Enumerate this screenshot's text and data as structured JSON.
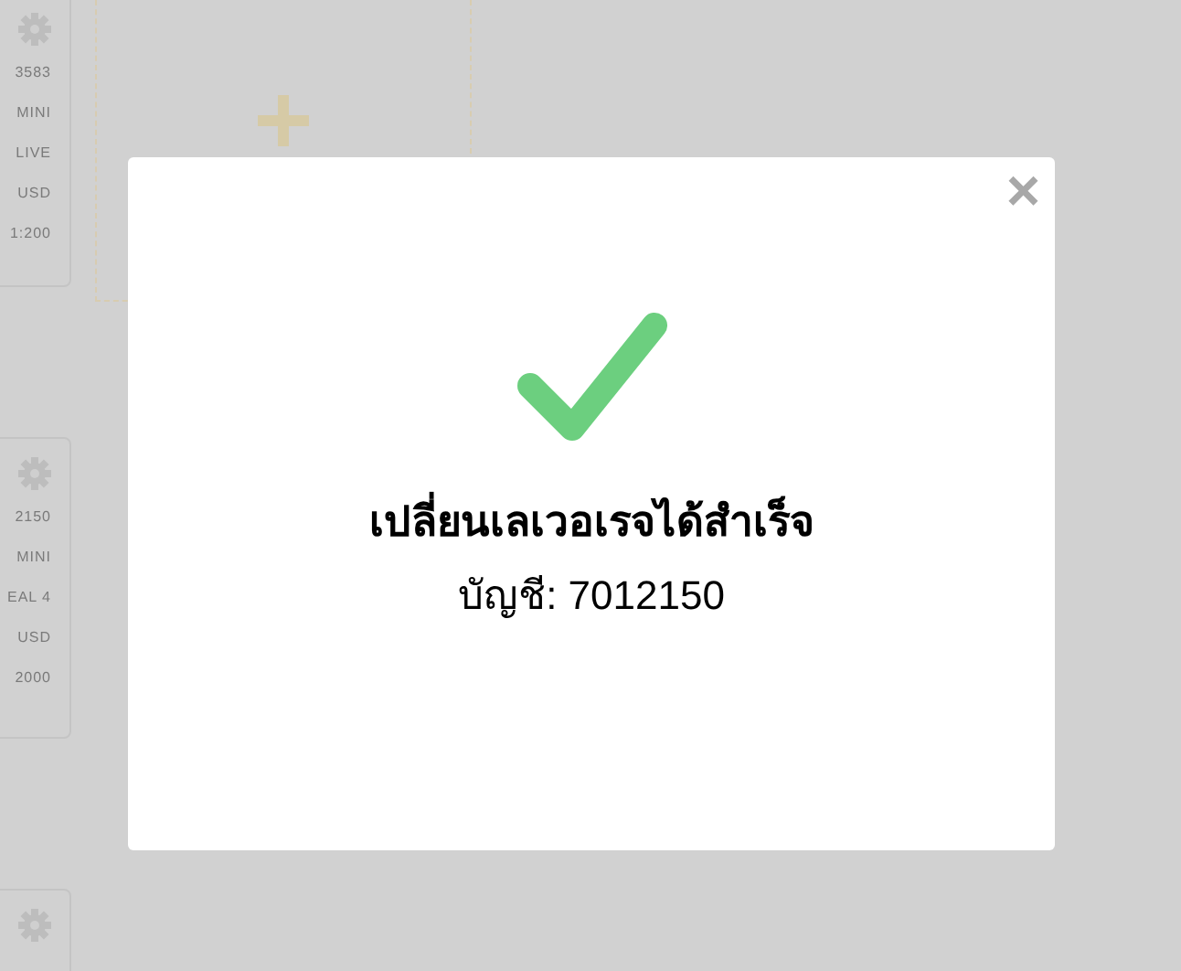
{
  "accounts": [
    {
      "lines": [
        "3583",
        "MINI",
        "LIVE",
        "USD",
        "1:200"
      ]
    },
    {
      "lines": [
        "2150",
        "MINI",
        "EAL 4",
        "USD",
        "2000"
      ]
    }
  ],
  "modal": {
    "close": "×",
    "title": "เปลี่ยนเลเวอเรจได้สำเร็จ",
    "message": "บัญชี: 7012150"
  }
}
